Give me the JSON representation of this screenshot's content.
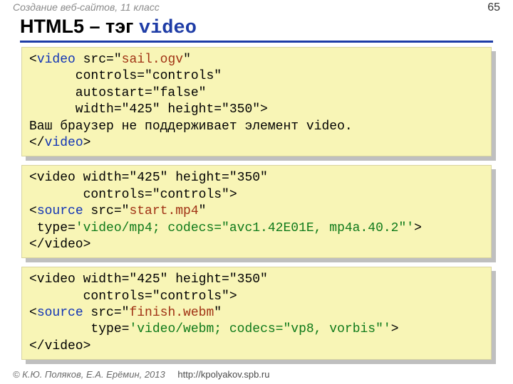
{
  "header": {
    "course_label": "Создание веб-сайтов, 11 класс",
    "page_number": "65"
  },
  "title": {
    "prefix": "HTML5 – тэг ",
    "tag": "video"
  },
  "blocks": {
    "b1": {
      "l1_open": "<",
      "l1_tag": "video",
      "l1_mid": " src=\"",
      "l1_src": "sail.ogv",
      "l1_end": "\"",
      "l2": "      controls=\"controls\"",
      "l3": "      autostart=\"false\"",
      "l4": "      width=\"425\" height=\"350\">",
      "l5": "Ваш браузер не поддерживает элемент video.",
      "l6_open": "</",
      "l6_tag": "video",
      "l6_close": ">"
    },
    "b2": {
      "l1": "<video width=\"425\" height=\"350\"",
      "l2": "       controls=\"controls\">",
      "l3_open": "<",
      "l3_tag": "source",
      "l3_mid": " src=\"",
      "l3_src": "start.mp4",
      "l3_end": "\"",
      "l4_pre": " type=",
      "l4_type": "'video/mp4; codecs=\"avc1.42E01E, mp4a.40.2\"'",
      "l4_close": ">",
      "l5": "</video>"
    },
    "b3": {
      "l1": "<video width=\"425\" height=\"350\"",
      "l2": "       controls=\"controls\">",
      "l3_open": "<",
      "l3_tag": "source",
      "l3_mid": " src=\"",
      "l3_src": "finish.webm",
      "l3_end": "\"",
      "l4_pre": "        type=",
      "l4_type": "'video/webm; codecs=\"vp8, vorbis\"'",
      "l4_close": ">",
      "l5": "</video>"
    }
  },
  "footer": {
    "copyright": "© К.Ю. Поляков, Е.А. Ерёмин, 2013",
    "url": "http://kpolyakov.spb.ru"
  }
}
